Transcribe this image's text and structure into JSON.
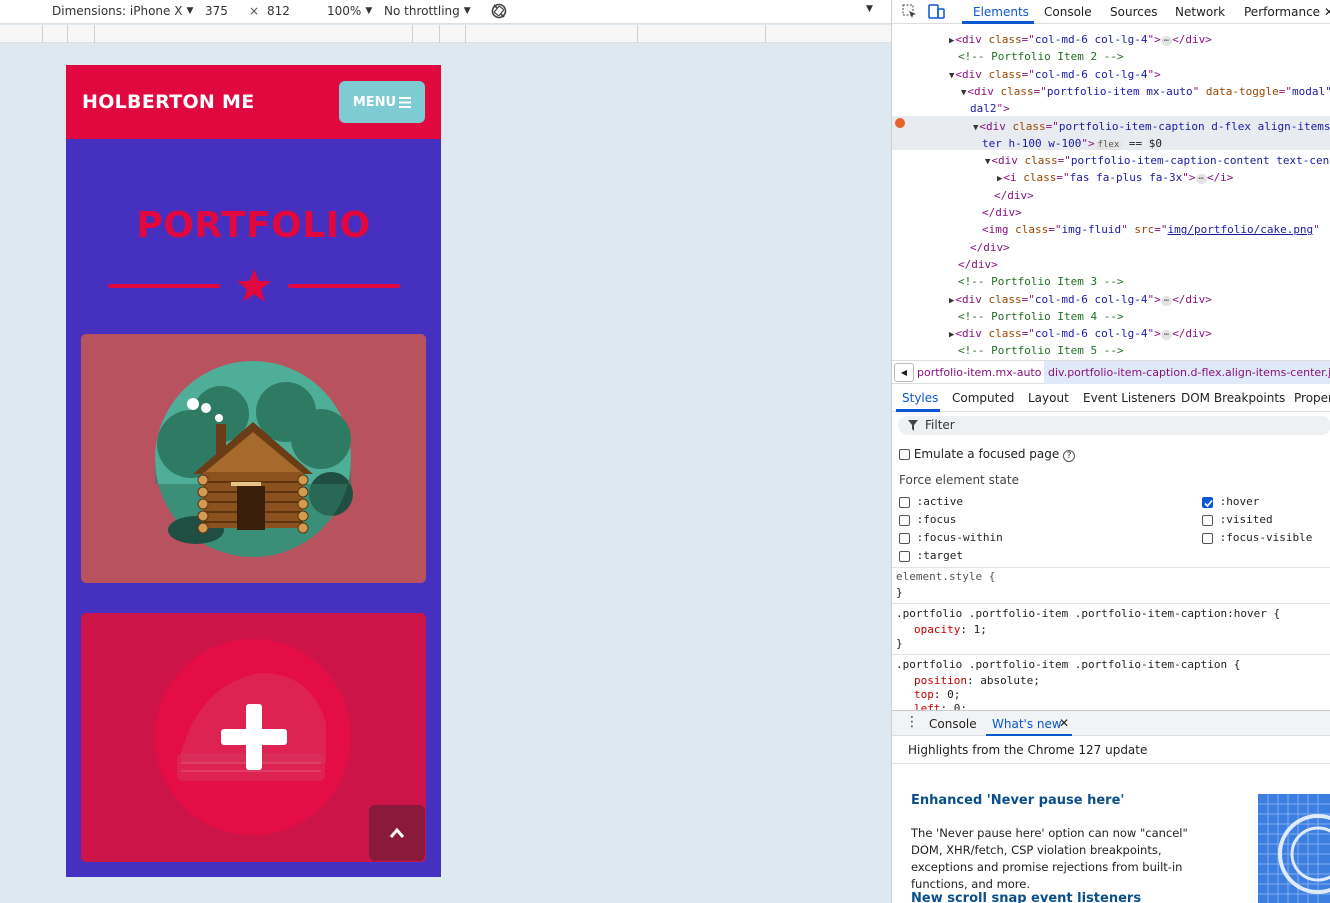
{
  "device_toolbar": {
    "dimensions_label": "Dimensions: iPhone X",
    "width": "375",
    "times": "×",
    "height": "812",
    "zoom": "100%",
    "throttling": "No throttling"
  },
  "phone": {
    "brand": "HOLBERTON ME",
    "menu_label": "MENU",
    "section_title": "PORTFOLIO"
  },
  "devtools": {
    "tabs": [
      "Elements",
      "Console",
      "Sources",
      "Network",
      "Performance"
    ],
    "dom_lines": [
      {
        "indent": 0,
        "arrow": "▶",
        "parts": [
          [
            "tg",
            "<div "
          ],
          [
            "an",
            "class"
          ],
          [
            "tg",
            "=\""
          ],
          [
            "av",
            "col-md-6 col-lg-4"
          ],
          [
            "tg",
            "\">"
          ],
          [
            "dots",
            "⋯"
          ],
          [
            "tg",
            "</div>"
          ]
        ]
      },
      {
        "indent": 0,
        "arrow": "",
        "parts": [
          [
            "cm",
            "<!-- Portfolio Item 2 -->"
          ]
        ]
      },
      {
        "indent": 0,
        "arrow": "▼",
        "parts": [
          [
            "tg",
            "<div "
          ],
          [
            "an",
            "class"
          ],
          [
            "tg",
            "=\""
          ],
          [
            "av",
            "col-md-6 col-lg-4"
          ],
          [
            "tg",
            "\">"
          ]
        ]
      },
      {
        "indent": 1,
        "arrow": "▼",
        "parts": [
          [
            "tg",
            "<div "
          ],
          [
            "an",
            "class"
          ],
          [
            "tg",
            "=\""
          ],
          [
            "av",
            "portfolio-item mx-auto"
          ],
          [
            "tg",
            "\" "
          ],
          [
            "an",
            "data-toggle"
          ],
          [
            "tg",
            "=\""
          ],
          [
            "av",
            "modal\""
          ]
        ]
      },
      {
        "indent": 1,
        "arrow": "",
        "parts": [
          [
            "av",
            "dal2"
          ],
          [
            "tg",
            "\">"
          ]
        ]
      },
      {
        "indent": 2,
        "arrow": "▼",
        "parts": [
          [
            "tg",
            "<div "
          ],
          [
            "an",
            "class"
          ],
          [
            "tg",
            "=\""
          ],
          [
            "av",
            "portfolio-item-caption d-flex align-items-cen"
          ]
        ]
      },
      {
        "indent": 2,
        "arrow": "",
        "parts": [
          [
            "av",
            "ter h-100 w-100"
          ],
          [
            "tg",
            "\">"
          ],
          [
            "dots",
            "flex"
          ],
          [
            "tx",
            " == $0"
          ]
        ]
      },
      {
        "indent": 3,
        "arrow": "▼",
        "parts": [
          [
            "tg",
            "<div "
          ],
          [
            "an",
            "class"
          ],
          [
            "tg",
            "=\""
          ],
          [
            "av",
            "portfolio-item-caption-content text-cen"
          ]
        ]
      },
      {
        "indent": 4,
        "arrow": "▶",
        "parts": [
          [
            "tg",
            "<i "
          ],
          [
            "an",
            "class"
          ],
          [
            "tg",
            "=\""
          ],
          [
            "av",
            "fas fa-plus fa-3x"
          ],
          [
            "tg",
            "\">"
          ],
          [
            "dots",
            "⋯"
          ],
          [
            "tg",
            "</i>"
          ]
        ]
      },
      {
        "indent": 3,
        "arrow": "",
        "parts": [
          [
            "tg",
            "</div>"
          ]
        ]
      },
      {
        "indent": 2,
        "arrow": "",
        "parts": [
          [
            "tg",
            "</div>"
          ]
        ]
      },
      {
        "indent": 2,
        "arrow": "",
        "parts": [
          [
            "tg",
            "<img "
          ],
          [
            "an",
            "class"
          ],
          [
            "tg",
            "=\""
          ],
          [
            "av",
            "img-fluid"
          ],
          [
            "tg",
            "\" "
          ],
          [
            "an",
            "src"
          ],
          [
            "tg",
            "=\""
          ],
          [
            "lnk",
            "img/portfolio/cake.png"
          ],
          [
            "tg",
            "\""
          ]
        ]
      },
      {
        "indent": 1,
        "arrow": "",
        "parts": [
          [
            "tg",
            "</div>"
          ]
        ]
      },
      {
        "indent": 0,
        "arrow": "",
        "parts": [
          [
            "tg",
            "</div>"
          ]
        ]
      },
      {
        "indent": 0,
        "arrow": "",
        "parts": [
          [
            "cm",
            "<!-- Portfolio Item 3 -->"
          ]
        ]
      },
      {
        "indent": 0,
        "arrow": "▶",
        "parts": [
          [
            "tg",
            "<div "
          ],
          [
            "an",
            "class"
          ],
          [
            "tg",
            "=\""
          ],
          [
            "av",
            "col-md-6 col-lg-4"
          ],
          [
            "tg",
            "\">"
          ],
          [
            "dots",
            "⋯"
          ],
          [
            "tg",
            "</div>"
          ]
        ]
      },
      {
        "indent": 0,
        "arrow": "",
        "parts": [
          [
            "cm",
            "<!-- Portfolio Item 4 -->"
          ]
        ]
      },
      {
        "indent": 0,
        "arrow": "▶",
        "parts": [
          [
            "tg",
            "<div "
          ],
          [
            "an",
            "class"
          ],
          [
            "tg",
            "=\""
          ],
          [
            "av",
            "col-md-6 col-lg-4"
          ],
          [
            "tg",
            "\">"
          ],
          [
            "dots",
            "⋯"
          ],
          [
            "tg",
            "</div>"
          ]
        ]
      },
      {
        "indent": 0,
        "arrow": "",
        "parts": [
          [
            "cm",
            "<!-- Portfolio Item 5 -->"
          ]
        ]
      }
    ],
    "breadcrumb": {
      "item1": "portfolio-item.mx-auto",
      "item2": "div.portfolio-item-caption.d-flex.align-items-center.ju"
    },
    "subtabs": [
      "Styles",
      "Computed",
      "Layout",
      "Event Listeners",
      "DOM Breakpoints",
      "Properties"
    ],
    "filter_placeholder": "Filter",
    "emulate_label": "Emulate a focused page",
    "force_state_label": "Force element state",
    "states_left": [
      ":active",
      ":focus",
      ":focus-within",
      ":target"
    ],
    "states_right": [
      ":hover",
      ":visited",
      ":focus-visible"
    ],
    "css": {
      "element_style": "element.style {",
      "close": "}",
      "rule1_selector": ".portfolio .portfolio-item .portfolio-item-caption:hover {",
      "rule1_prop": "opacity",
      "rule1_val": "1;",
      "rule2_selector": ".portfolio .portfolio-item .portfolio-item-caption {",
      "rule2_prop1": "position",
      "rule2_val1": "absolute;",
      "rule2_prop2": "top",
      "rule2_val2": "0;",
      "rule2_prop3": "left",
      "rule2_val3": "0;"
    },
    "drawer_tabs": [
      "Console",
      "What's new"
    ],
    "whats_new": {
      "highlight": "Highlights from the Chrome 127 update",
      "h1": "Enhanced 'Never pause here'",
      "p1": "The 'Never pause here' option can now \"cancel\" DOM, XHR/fetch, CSP violation breakpoints, exceptions and promise rejections from built-in functions, and more.",
      "h2": "New scroll snap event listeners"
    }
  },
  "colors": {
    "nav": "#e0083f",
    "section": "#4530c0",
    "menu": "#7fcbd3",
    "card1": "#b8525f",
    "card2": "#cd1449",
    "accent": "#0b57d0"
  }
}
